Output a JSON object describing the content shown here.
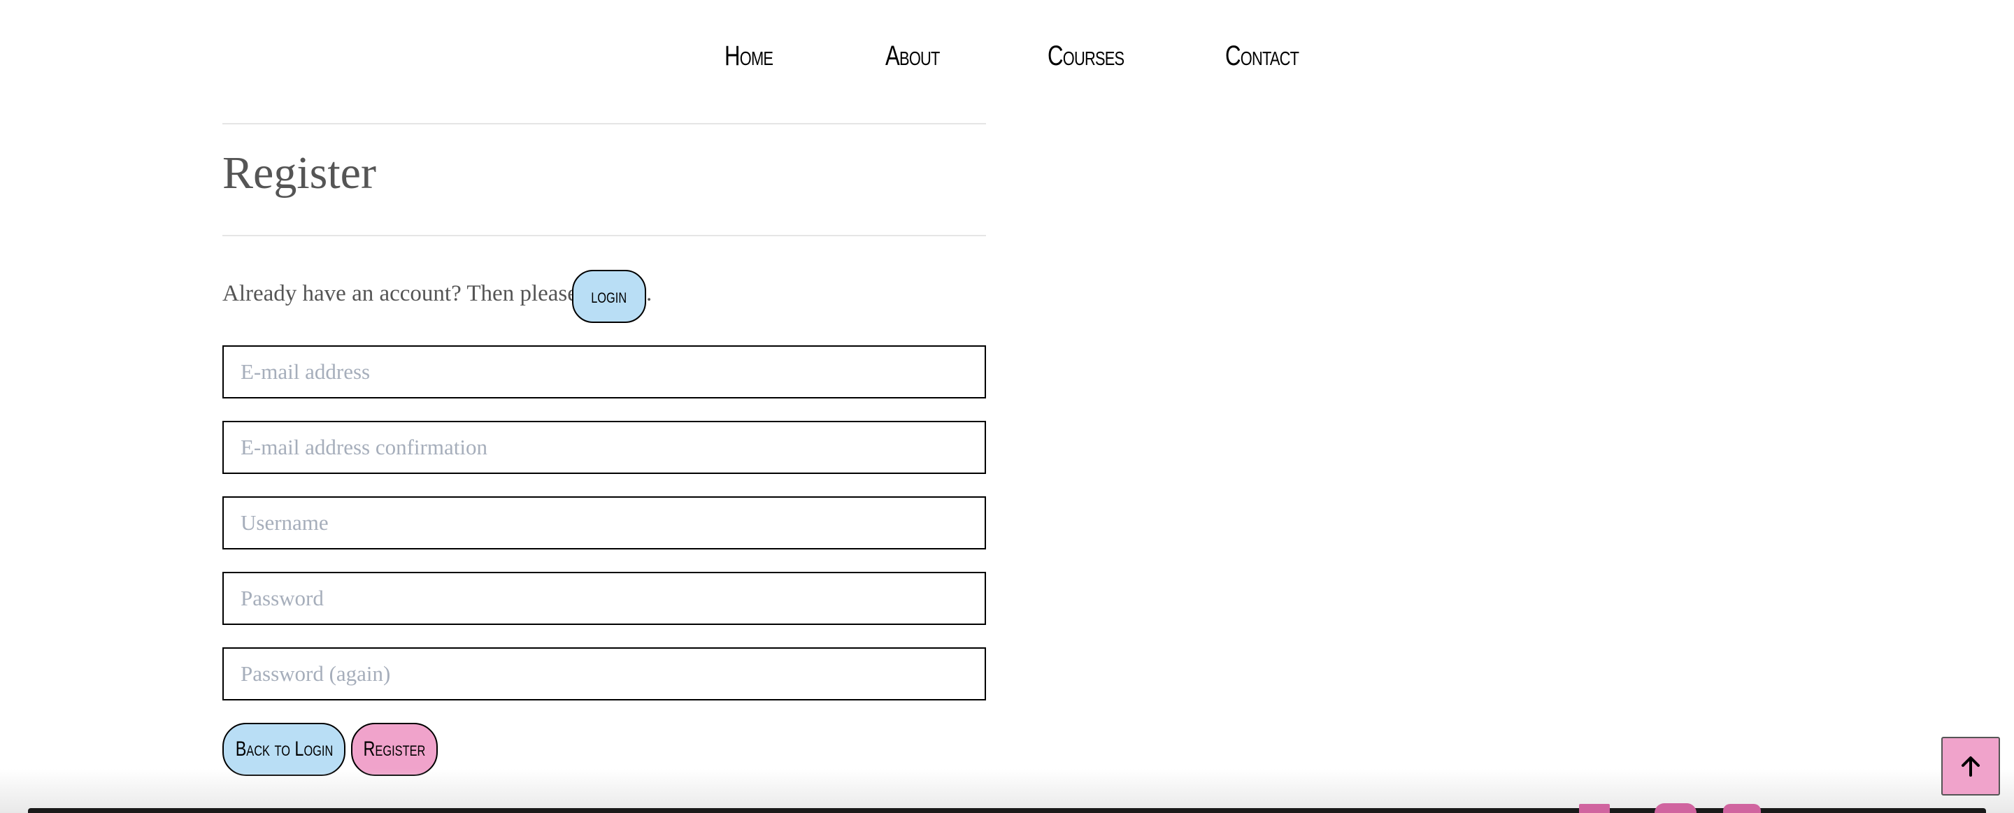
{
  "nav": {
    "items": [
      {
        "label": "Home"
      },
      {
        "label": "About"
      },
      {
        "label": "Courses"
      },
      {
        "label": "Contact"
      }
    ]
  },
  "register": {
    "title": "Register",
    "already_text": "Already have an account? Then please",
    "already_suffix": ".",
    "login_button": "login",
    "fields": {
      "email_placeholder": "E-mail address",
      "email_confirm_placeholder": "E-mail address confirmation",
      "username_placeholder": "Username",
      "password_placeholder": "Password",
      "password_again_placeholder": "Password (again)"
    },
    "back_to_login_button": "Back to Login",
    "register_button": "Register"
  },
  "scroll_top": {
    "icon": "arrow-up-icon"
  },
  "colors": {
    "accent_pink": "#f0a3cb",
    "accent_blue": "#b9def5",
    "text": "#555555"
  }
}
